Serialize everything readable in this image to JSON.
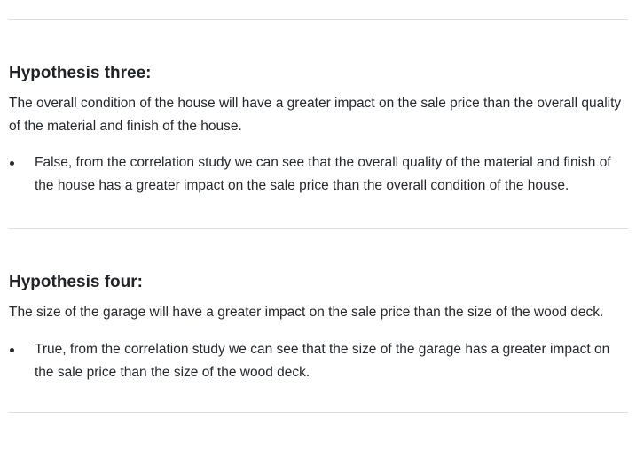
{
  "sections": [
    {
      "title": "Hypothesis three:",
      "statement": "The overall condition of the house will have a greater impact on the sale price than the overall quality of the material and finish of the house.",
      "bullets": [
        "False, from the correlation study we can see that the overall quality of the material and finish of the house has a greater impact on the sale price than the overall condition of the house."
      ]
    },
    {
      "title": "Hypothesis four:",
      "statement": "The size of the garage will have a greater impact on the sale price than the size of the wood deck.",
      "bullets": [
        "True, from the correlation study we can see that the size of the garage has a greater impact on the sale price than the size of the wood deck."
      ]
    }
  ]
}
